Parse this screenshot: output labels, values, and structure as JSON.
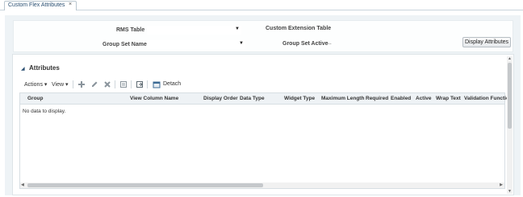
{
  "tab": {
    "label": "Custom Flex Attributes",
    "close": "×"
  },
  "form": {
    "rms_table_label": "RMS Table",
    "group_set_name_label": "Group Set Name",
    "custom_extension_table_label": "Custom Extension Table",
    "group_set_active_label": "Group Set Active",
    "group_set_active_value": "...",
    "display_attributes_button": "Display Attributes",
    "dropdown_arrow": "▼"
  },
  "attributes": {
    "title": "Attributes",
    "collapse_icon": "◢",
    "toolbar": {
      "actions": "Actions ▾",
      "view": "View ▾",
      "detach": "Detach"
    },
    "columns": [
      "Group",
      "View Column Name",
      "Display Order",
      "Data Type",
      "Widget Type",
      "Maximum Length",
      "Required",
      "Enabled",
      "Active",
      "Wrap Text",
      "Validation Functio"
    ],
    "empty_text": "No data to display."
  },
  "colors": {
    "accent": "#2a4f72",
    "panel_bg": "#eef3f6",
    "header_bg": "#eef2f5"
  }
}
